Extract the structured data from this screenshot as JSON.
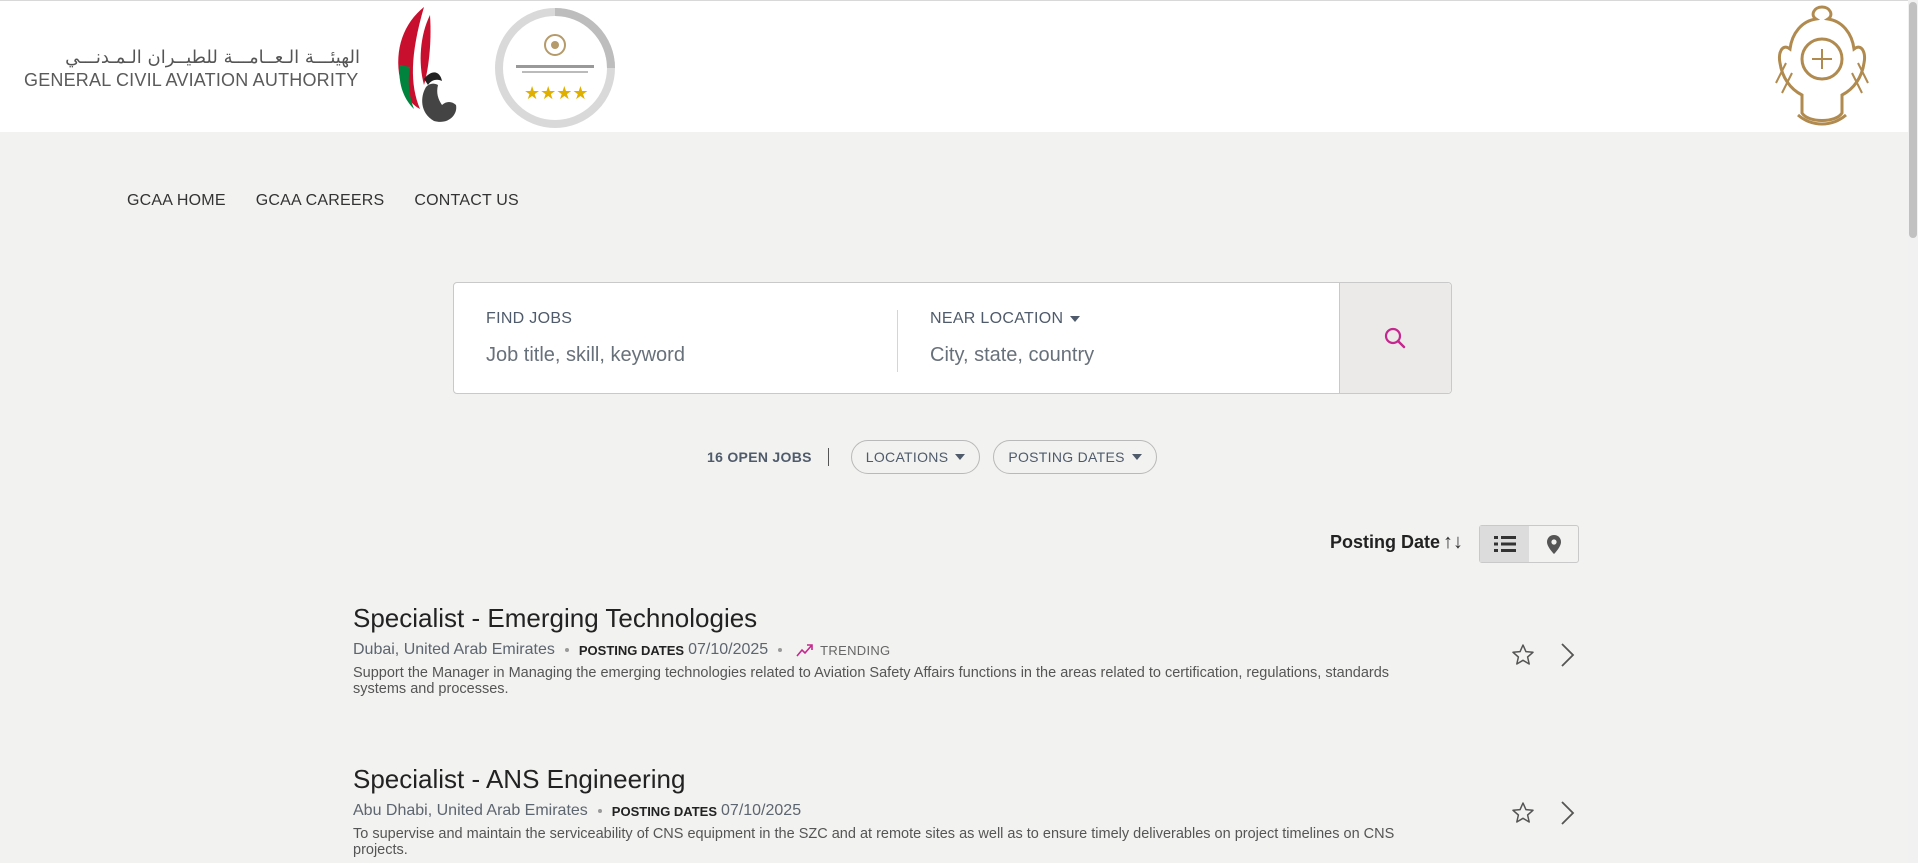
{
  "header": {
    "logo_arabic": "الهيئـــة الـعــامـــة للطيــران الـمـدنـــي",
    "logo_english": "GENERAL CIVIL AVIATION AUTHORITY",
    "falcon_logo_icon": "falcon-logo-icon",
    "award_icon": "global-star-rating-award-icon",
    "emblem_icon": "uae-emblem-icon"
  },
  "nav": {
    "items": [
      {
        "label": "GCAA HOME"
      },
      {
        "label": "GCAA CAREERS"
      },
      {
        "label": "CONTACT US"
      }
    ]
  },
  "search": {
    "find_label": "FIND JOBS",
    "find_placeholder": "Job title, skill, keyword",
    "near_label": "NEAR LOCATION",
    "near_placeholder": "City, state, country",
    "button_icon": "search-icon",
    "accent_color": "#c4288e"
  },
  "filters": {
    "open_jobs": "16 OPEN JOBS",
    "locations": "LOCATIONS",
    "posting_dates": "POSTING DATES"
  },
  "sort": {
    "label": "Posting Date",
    "arrows": "↑↓",
    "list_view_icon": "list-icon",
    "map_view_icon": "map-pin-icon",
    "active_view": "list"
  },
  "jobs": [
    {
      "title": "Specialist - Emerging Technologies",
      "location": "Dubai, United Arab Emirates",
      "posting_label": "POSTING DATES",
      "posting_date": "07/10/2025",
      "trending": "TRENDING",
      "description": "Support the Manager in Managing the emerging technologies related to Aviation Safety Affairs functions in the areas related to certification, regulations, standards systems and processes."
    },
    {
      "title": "Specialist - ANS Engineering",
      "location": "Abu Dhabi, United Arab Emirates",
      "posting_label": "POSTING DATES",
      "posting_date": "07/10/2025",
      "description": "To supervise and maintain the serviceability of CNS equipment in the SZC and at remote sites as well as to ensure timely deliverables on project timelines on CNS projects."
    }
  ]
}
